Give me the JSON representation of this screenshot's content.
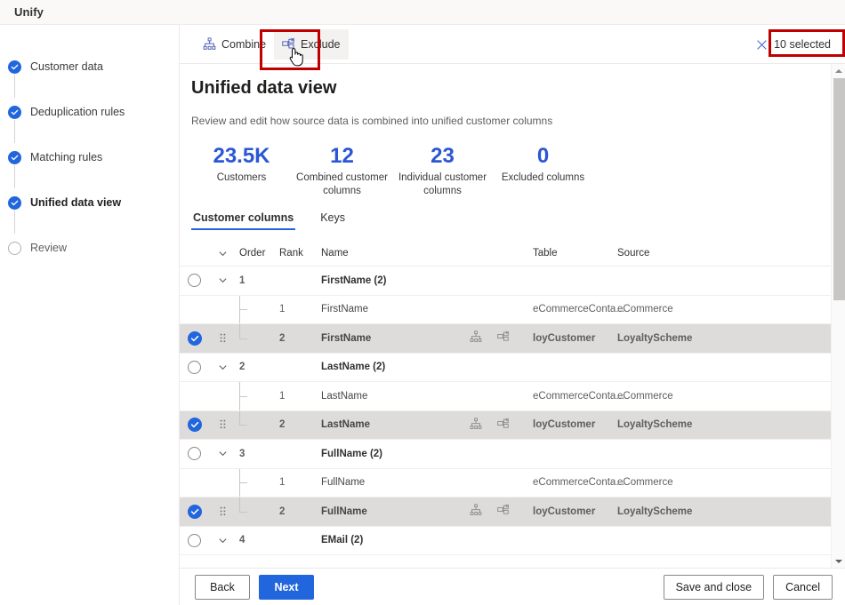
{
  "window": {
    "title": "Unify"
  },
  "sidebar": {
    "items": [
      {
        "label": "Customer data",
        "state": "done",
        "icon": "check-circle-icon"
      },
      {
        "label": "Deduplication rules",
        "state": "done",
        "icon": "check-circle-icon"
      },
      {
        "label": "Matching rules",
        "state": "done",
        "icon": "check-circle-icon"
      },
      {
        "label": "Unified data view",
        "state": "done-active",
        "icon": "check-circle-icon"
      },
      {
        "label": "Review",
        "state": "todo",
        "icon": "empty-circle-icon"
      }
    ]
  },
  "toolbar": {
    "combine_label": "Combine",
    "combine_icon": "combine-icon",
    "exclude_label": "Exclude",
    "exclude_icon": "exclude-icon",
    "selected_label": "10 selected",
    "selected_icon": "close-x-icon",
    "highlight_color": "#c00000"
  },
  "main": {
    "title": "Unified data view",
    "subtitle": "Review and edit how source data is combined into unified customer columns",
    "kpis": [
      {
        "value": "23.5K",
        "label": "Customers"
      },
      {
        "value": "12",
        "label": "Combined customer columns"
      },
      {
        "value": "23",
        "label": "Individual customer columns"
      },
      {
        "value": "0",
        "label": "Excluded columns"
      }
    ],
    "accent_color": "#2b56d4",
    "tabs": [
      {
        "label": "Customer columns",
        "active": true
      },
      {
        "label": "Keys",
        "active": false
      }
    ],
    "table": {
      "headers": {
        "chevron": "",
        "order": "Order",
        "rank": "Rank",
        "name": "Name",
        "actions": "",
        "table": "Table",
        "source": "Source"
      },
      "rows": [
        {
          "kind": "group",
          "checked": false,
          "order": "1",
          "rank": "",
          "name": "FirstName (2)",
          "table": "",
          "source": ""
        },
        {
          "kind": "child",
          "checked": false,
          "order": "",
          "rank": "1",
          "name": "FirstName",
          "table": "eCommerceConta...",
          "source": "eCommerce"
        },
        {
          "kind": "child-selected",
          "checked": true,
          "order": "",
          "rank": "2",
          "name": "FirstName",
          "table": "loyCustomer",
          "source": "LoyaltyScheme"
        },
        {
          "kind": "group",
          "checked": false,
          "order": "2",
          "rank": "",
          "name": "LastName (2)",
          "table": "",
          "source": ""
        },
        {
          "kind": "child",
          "checked": false,
          "order": "",
          "rank": "1",
          "name": "LastName",
          "table": "eCommerceConta...",
          "source": "eCommerce"
        },
        {
          "kind": "child-selected",
          "checked": true,
          "order": "",
          "rank": "2",
          "name": "LastName",
          "table": "loyCustomer",
          "source": "LoyaltyScheme"
        },
        {
          "kind": "group",
          "checked": false,
          "order": "3",
          "rank": "",
          "name": "FullName (2)",
          "table": "",
          "source": ""
        },
        {
          "kind": "child",
          "checked": false,
          "order": "",
          "rank": "1",
          "name": "FullName",
          "table": "eCommerceConta...",
          "source": "eCommerce"
        },
        {
          "kind": "child-selected",
          "checked": true,
          "order": "",
          "rank": "2",
          "name": "FullName",
          "table": "loyCustomer",
          "source": "LoyaltyScheme"
        },
        {
          "kind": "group",
          "checked": false,
          "order": "4",
          "rank": "",
          "name": "EMail (2)",
          "table": "",
          "source": ""
        }
      ]
    }
  },
  "footer": {
    "back_label": "Back",
    "next_label": "Next",
    "save_label": "Save and close",
    "cancel_label": "Cancel"
  },
  "scrollbar": {
    "up_icon": "triangle-up-icon",
    "down_icon": "triangle-down-icon"
  },
  "cursor": {
    "icon": "pointing-hand-cursor"
  }
}
